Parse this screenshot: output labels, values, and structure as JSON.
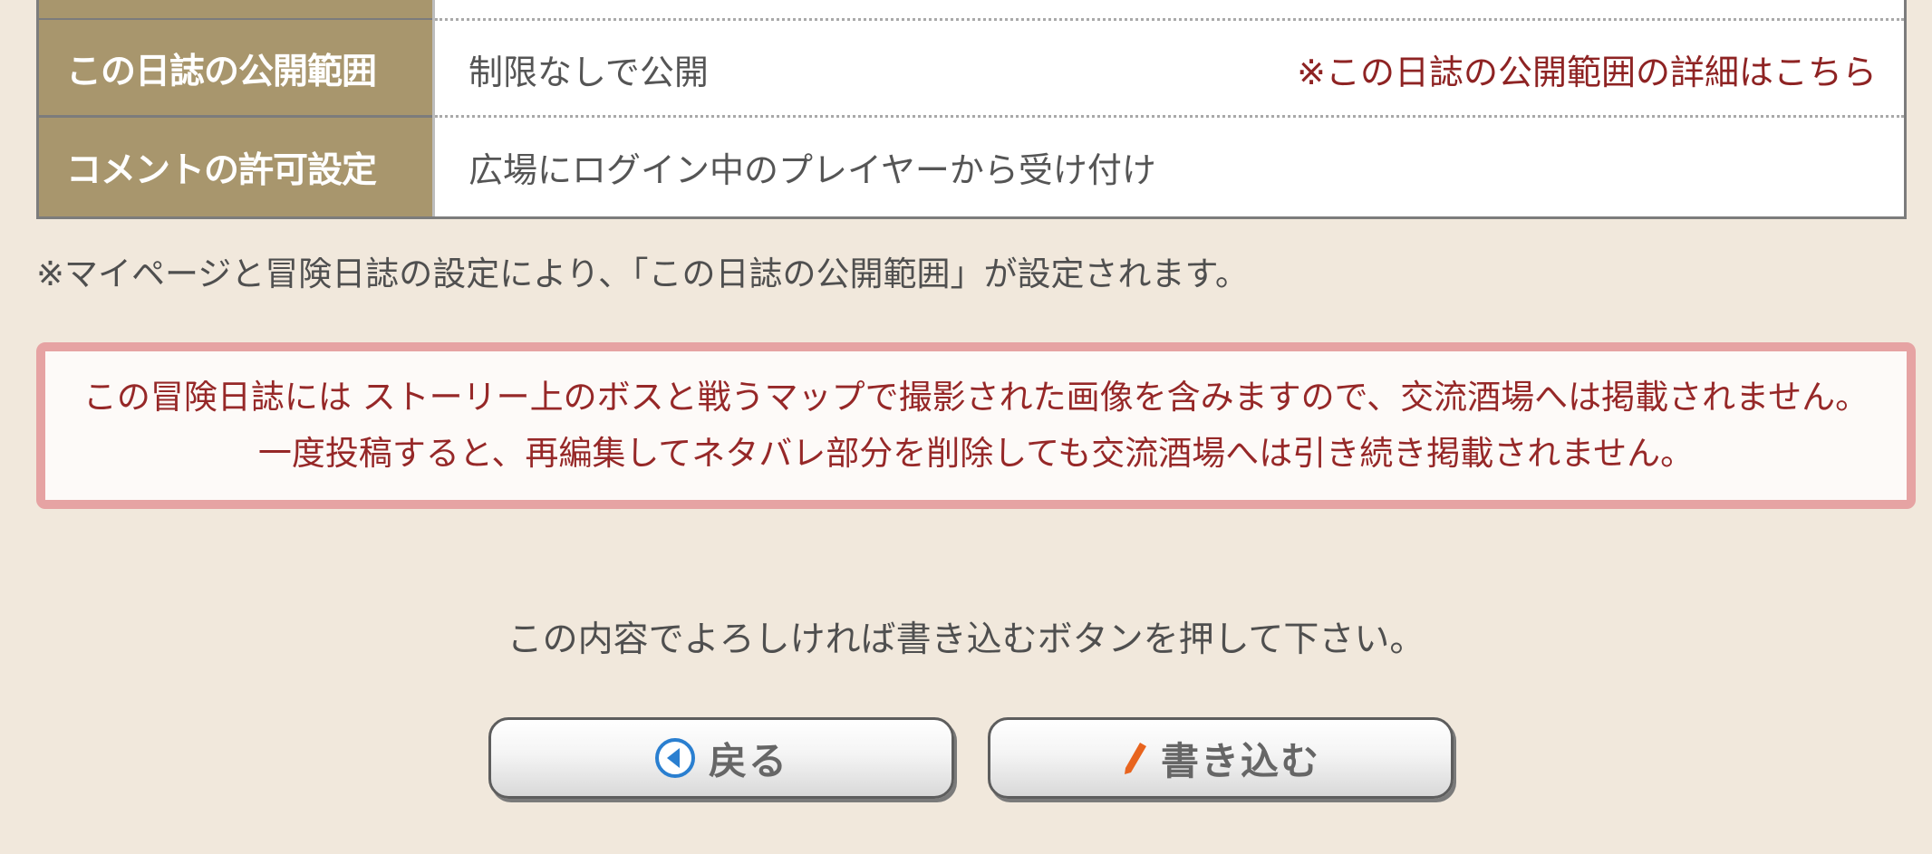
{
  "settings": {
    "scope_label": "この日誌の公開範囲",
    "scope_value": "制限なしで公開",
    "scope_detail_link": "※この日誌の公開範囲の詳細はこちら",
    "comment_label": "コメントの許可設定",
    "comment_value": "広場にログイン中のプレイヤーから受け付け"
  },
  "settings_note": "※マイページと冒険日誌の設定により、「この日誌の公開範囲」が設定されます。",
  "warning": {
    "line1": "この冒険日誌には ストーリー上のボスと戦うマップで撮影された画像を含みますので、交流酒場へは掲載されません。",
    "line2": "一度投稿すると、再編集してネタバレ部分を削除しても交流酒場へは引き続き掲載されません。"
  },
  "instruction": "この内容でよろしければ書き込むボタンを押して下さい。",
  "buttons": {
    "back": {
      "label": "戻る",
      "icon": "back-arrow-icon"
    },
    "write": {
      "label": "書き込む",
      "icon": "pencil-icon"
    }
  },
  "colors": {
    "page_background": "#f1e8dc",
    "header_cell": "#a8966d",
    "link_red": "#8e2323",
    "warning_border": "#e6a3a3",
    "warning_text": "#962828",
    "back_icon_blue": "#2a7fd0",
    "pencil_orange": "#e8641e"
  }
}
